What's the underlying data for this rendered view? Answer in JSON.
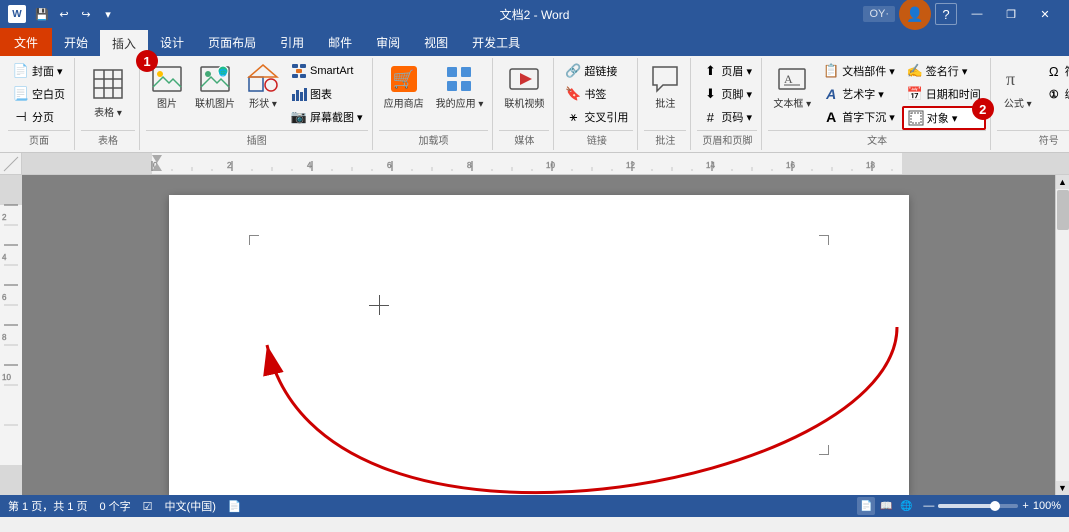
{
  "titlebar": {
    "title": "文档2 - Word",
    "search_label": "OY·",
    "quick_access": [
      "save",
      "undo",
      "redo",
      "customize"
    ],
    "window_controls": [
      "minimize",
      "restore",
      "close"
    ],
    "help": "?"
  },
  "ribbon": {
    "tabs": [
      "文件",
      "开始",
      "插入",
      "设计",
      "页面布局",
      "引用",
      "邮件",
      "审阅",
      "视图",
      "开发工具"
    ],
    "active_tab": "插入",
    "groups": {
      "pages": {
        "label": "页面",
        "items": [
          "封面",
          "空白页",
          "分页"
        ]
      },
      "tables": {
        "label": "表格",
        "items": [
          "表格"
        ]
      },
      "illustrations": {
        "label": "插图",
        "items": [
          "图片",
          "联机图片",
          "形状",
          "SmartArt",
          "图表",
          "屏幕截图"
        ]
      },
      "apps": {
        "label": "加载项",
        "items": [
          "应用商店",
          "我的应用"
        ]
      },
      "media": {
        "label": "媒体",
        "items": [
          "联机视频"
        ]
      },
      "links": {
        "label": "链接",
        "items": [
          "超链接",
          "书签",
          "交叉引用"
        ]
      },
      "comments": {
        "label": "批注",
        "items": [
          "批注"
        ]
      },
      "header_footer": {
        "label": "页眉和页脚",
        "items": [
          "页眉",
          "页脚",
          "页码"
        ]
      },
      "text": {
        "label": "文本",
        "items": [
          "文本框",
          "文档部件",
          "艺术字",
          "首字下沉",
          "签名行",
          "日期和时间",
          "对象"
        ]
      },
      "symbols": {
        "label": "符号",
        "items": [
          "公式",
          "符号",
          "编号"
        ]
      }
    }
  },
  "status_bar": {
    "page_info": "第 1 页，共 1 页",
    "word_count": "0 个字",
    "language": "中文(中国)",
    "zoom": "100%"
  },
  "annotations": [
    {
      "id": 1,
      "label": "1"
    },
    {
      "id": 2,
      "label": "2"
    }
  ]
}
